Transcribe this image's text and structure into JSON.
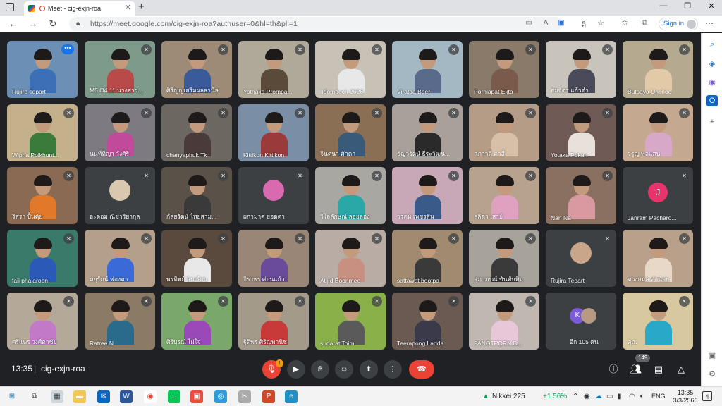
{
  "browser": {
    "tab_title": "Meet - cig-exjn-roa",
    "tab_close": "✕",
    "new_tab": "+",
    "url": "https://meet.google.com/cig-exjn-roa?authuser=0&hl=th&pli=1",
    "sign_in": "Sign in",
    "window_controls": [
      "—",
      "❐",
      "✕"
    ]
  },
  "meeting": {
    "time": "13:35",
    "separator": "|",
    "code": "cig-exjn-roa",
    "participant_count": "149",
    "mic_badge": "!"
  },
  "participants": [
    {
      "name": "Rujira Tepart",
      "bg": "#6b8fb5",
      "kind": "person",
      "shirt": "#3b6fb6",
      "self": true
    },
    {
      "name": "M5 O4 11 นางสาว...",
      "bg": "#7e9a8a",
      "kind": "person",
      "shirt": "#b94a4a"
    },
    {
      "name": "ศิริญญเสริมผลสานิล",
      "bg": "#9d8b78",
      "kind": "person",
      "shirt": "#3a5a9a"
    },
    {
      "name": "Yothaka Prompa...",
      "bg": "#b0a898",
      "kind": "person",
      "shirt": "#5a4a3a"
    },
    {
      "name": "udomdech 2526",
      "bg": "#c8c2b6",
      "kind": "person",
      "shirt": "#e8e8e8"
    },
    {
      "name": "Viratda Beer",
      "bg": "#a4b8c4",
      "kind": "person",
      "shirt": "#5a6a8a"
    },
    {
      "name": "Pornlapat Ekta",
      "bg": "#8a7a6a",
      "kind": "person",
      "shirt": "#7a5a4a"
    },
    {
      "name": "สมจิตร แก้วดำ",
      "bg": "#c9c4bb",
      "kind": "person",
      "shirt": "#4a4a5a"
    },
    {
      "name": "Butsaya Unchoo",
      "bg": "#b5a98f",
      "kind": "person",
      "shirt": "#e2c9a8"
    },
    {
      "name": "Wipha Polkhunt...",
      "bg": "#c4b08a",
      "kind": "person",
      "shirt": "#3a7a3a"
    },
    {
      "name": "นนท์ทิญา วังศิริ",
      "bg": "#7e7a82",
      "kind": "person",
      "shirt": "#c24a9a"
    },
    {
      "name": "chanyaphuk Tk",
      "bg": "#6c6760",
      "kind": "person",
      "shirt": "#4a3a3a"
    },
    {
      "name": "Kittikon Kittikon",
      "bg": "#7a8fa6",
      "kind": "person",
      "shirt": "#9a3a3a"
    },
    {
      "name": "จินตนา ศักดา",
      "bg": "#8b6f55",
      "kind": "person",
      "shirt": "#3a5a7a"
    },
    {
      "name": "ธัญวรัตน์ ธีระวัฒน...",
      "bg": "#a8a099",
      "kind": "person",
      "shirt": "#2a2a2a"
    },
    {
      "name": "สุภาวดี คาสี",
      "bg": "#b59c86",
      "kind": "person",
      "shirt": "#d8c0a8"
    },
    {
      "name": "Yotaka Pokan",
      "bg": "#6f5a56",
      "kind": "person",
      "shirt": "#e8e0da"
    },
    {
      "name": "จรูญ พลแสน",
      "bg": "#c4a890",
      "kind": "person",
      "shirt": "#d8a8c8"
    },
    {
      "name": "ริสรา ปั้นคุ้ย",
      "bg": "#8a6a52",
      "kind": "person",
      "shirt": "#e07a2a"
    },
    {
      "name": "อะดอม ณิชาริยากุล",
      "bg": "#3c4043",
      "kind": "avatar",
      "avatar": "#d9c7b0"
    },
    {
      "name": "กัลยรัตน์ ไทยสาม...",
      "bg": "#5a5248",
      "kind": "person",
      "shirt": "#3a3a3a"
    },
    {
      "name": "ผกามาศ ยอดดา",
      "bg": "#3c4043",
      "kind": "avatar",
      "avatar": "#d86ab0"
    },
    {
      "name": "วิไลลักษณ์ ลอยลอง",
      "bg": "#a9a7a2",
      "kind": "person",
      "shirt": "#2aa8a8"
    },
    {
      "name": "วรุตม์ เพชรสิน",
      "bg": "#c8a8b6",
      "kind": "person",
      "shirt": "#3a5a8a"
    },
    {
      "name": "ลลิตา เสาย์",
      "bg": "#b7a28e",
      "kind": "person",
      "shirt": "#e0a0c0"
    },
    {
      "name": "Nan Na",
      "bg": "#8a7060",
      "kind": "person",
      "shirt": "#d89aa0"
    },
    {
      "name": "Janram Pacharo...",
      "bg": "#3c4043",
      "kind": "letter",
      "letter": "J"
    },
    {
      "name": "faii phaiaroen",
      "bg": "#3a7a6a",
      "kind": "person",
      "shirt": "#2a5ab8"
    },
    {
      "name": "มยุรัตน์ ฟองดา",
      "bg": "#b4a08a",
      "kind": "person",
      "shirt": "#3a6ad8"
    },
    {
      "name": "พรทิพย์ อินเรือน",
      "bg": "#5a4a3e",
      "kind": "person",
      "shirt": "#e8e8e8"
    },
    {
      "name": "จิราพร ศ่อนแก้ว",
      "bg": "#9a8676",
      "kind": "person",
      "shirt": "#6a4a9a"
    },
    {
      "name": "Atijid Boonmee",
      "bg": "#b8aca4",
      "kind": "person",
      "shirt": "#c89080"
    },
    {
      "name": "sattawat bootpa",
      "bg": "#a08a70",
      "kind": "person",
      "shirt": "#3a3a3a"
    },
    {
      "name": "สุภาภรณ์ ขันทับทิม",
      "bg": "#a7a29a",
      "kind": "person",
      "shirt": "#3a3a3a"
    },
    {
      "name": "Rujira Tepart",
      "bg": "#3c4043",
      "kind": "avatar",
      "avatar": "#c9a68a"
    },
    {
      "name": "ดวงกมล คำน้อย",
      "bg": "#b8a08a",
      "kind": "person",
      "shirt": "#e8d8c8"
    },
    {
      "name": "ศรีแพร วงศ์ตาชัย",
      "bg": "#b4a898",
      "kind": "person",
      "shirt": "#c27ac8"
    },
    {
      "name": "Ratree N",
      "bg": "#8a7a66",
      "kind": "person",
      "shirt": "#2a6a8a"
    },
    {
      "name": "ศิริบุรณ์ ไฝใจ",
      "bg": "#7aa86a",
      "kind": "person",
      "shirt": "#9a4ab8"
    },
    {
      "name": "ฐิติพร ศิริญพานิช",
      "bg": "#a49a8a",
      "kind": "person",
      "shirt": "#c83a3a"
    },
    {
      "name": "sudarat Toim",
      "bg": "#8ab04a",
      "kind": "person",
      "shirt": "#5a5a5a"
    },
    {
      "name": "Teerapong Ladda",
      "bg": "#6a5a52",
      "kind": "person",
      "shirt": "#3a3a4a"
    },
    {
      "name": "PANOTPORN B...",
      "bg": "#c0b8b0",
      "kind": "person",
      "shirt": "#e8c8d8"
    },
    {
      "name": "อีก 105 คน",
      "bg": "#3c4043",
      "kind": "more",
      "letter": "K"
    },
    {
      "name": "คุณ",
      "bg": "#d8c8a0",
      "kind": "person",
      "shirt": "#2aa8c8"
    }
  ],
  "icons": {
    "mic_off": "✕",
    "controls": [
      "mic-off-icon",
      "camera-off-icon",
      "raise-hand-icon",
      "emoji-icon",
      "present-icon",
      "more-options-icon",
      "end-call-icon"
    ],
    "right": [
      "info-icon",
      "people-icon",
      "chat-icon",
      "activities-icon"
    ]
  },
  "taskbar": {
    "ticker": "Nikkei 225",
    "change": "+1.56%",
    "lang": "ENG",
    "time": "13:35",
    "date": "3/3/2566",
    "notifications": "4"
  }
}
